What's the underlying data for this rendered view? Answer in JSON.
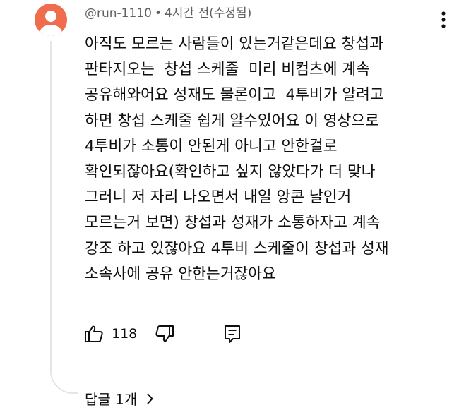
{
  "comment": {
    "author": "@run-1110",
    "separator": "•",
    "time": "4시간 전(수정됨)",
    "lines": [
      "아직도 모르는 사람들이 있는거같은데요 창섭과",
      "판타지오는  창섭 스케줄  미리 비컴츠에 계속",
      "공유해와어요 성재도 물론이고  4투비가 알려고",
      "하면 창섭 스케줄 쉽게 알수있어요 이 영상으로",
      "4투비가 소통이 안된게 아니고 안한걸로",
      "확인되잖아요(확인하고 싶지 않았다가 더 맞나",
      "그러니 저 자리 나오면서 내일 앙콘 날인거",
      "모르는거 보면) 창섭과 성재가 소통하자고 계속",
      "강조 하고 있잖아요 4투비 스케줄이 창섭과 성재",
      "소속사에 공유 안한는거잖아요"
    ],
    "like_count": "118",
    "replies_label": "답글 1개"
  },
  "icons": {
    "avatar": "default-user-avatar",
    "menu": "more-vertical-icon",
    "like": "thumbs-up-icon",
    "dislike": "thumbs-down-icon",
    "reply": "reply-comment-icon",
    "replies_chevron": "chevron-right-icon"
  },
  "colors": {
    "avatar_bg": "#ef6c4d",
    "text": "#0f0f0f",
    "meta_text": "#606060",
    "thread_line": "#e5e5e5"
  }
}
